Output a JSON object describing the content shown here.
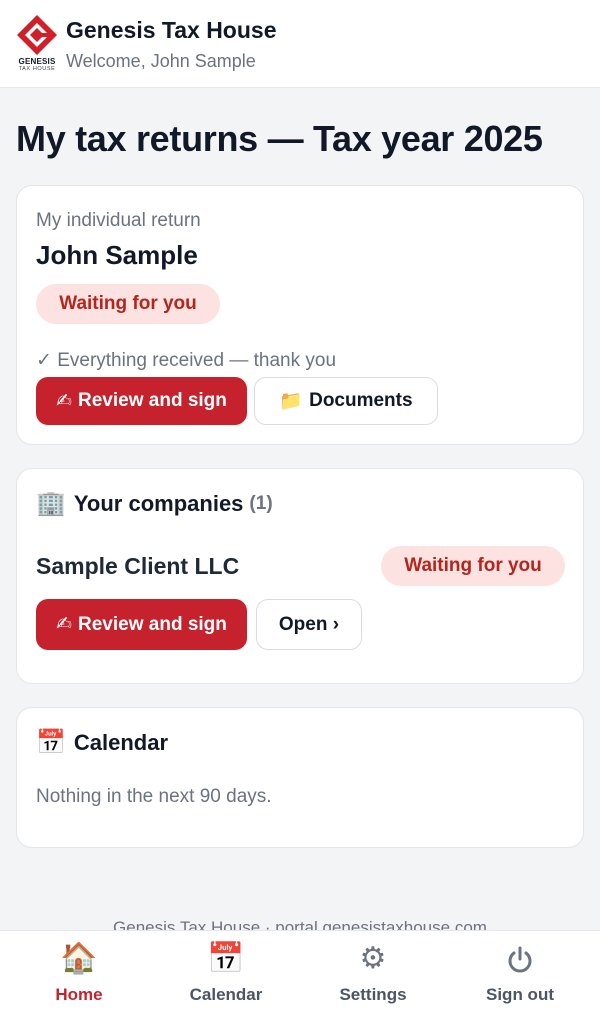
{
  "header": {
    "brand_title": "Genesis Tax House",
    "welcome": "Welcome, John Sample",
    "logo": {
      "word": "GENESIS",
      "sub": "TAX HOUSE",
      "color": "#d11f2a"
    }
  },
  "page_title": "My tax returns — Tax year 2025",
  "individual": {
    "kicker": "My individual return",
    "name": "John Sample",
    "status_badge": "Waiting for you",
    "status_line": "✓ Everything received — thank you",
    "sign_button": {
      "icon": "✍",
      "label": "Review and sign"
    },
    "documents_button": {
      "icon": "📁",
      "label": "Documents"
    }
  },
  "companies": {
    "icon": "🏢",
    "title": "Your companies",
    "count": "(1)",
    "items": [
      {
        "name": "Sample Client LLC",
        "status_badge": "Waiting for you",
        "sign_button": {
          "icon": "✍",
          "label": "Review and sign"
        },
        "open_button": "Open ›"
      }
    ]
  },
  "calendar": {
    "icon": "📅",
    "title": "Calendar",
    "empty": "Nothing in the next 90 days."
  },
  "footer": "Genesis Tax House · portal.genesistaxhouse.com",
  "nav": [
    {
      "icon": "🏠",
      "label": "Home",
      "active": true
    },
    {
      "icon": "📅",
      "label": "Calendar"
    },
    {
      "icon": "⚙",
      "label": "Settings"
    },
    {
      "icon": "⏻",
      "label": "Sign out"
    }
  ],
  "colors": {
    "accent": "#c5222d",
    "badge_bg": "#fde2e2",
    "badge_text": "#b3261e",
    "background": "#f3f4f6"
  }
}
